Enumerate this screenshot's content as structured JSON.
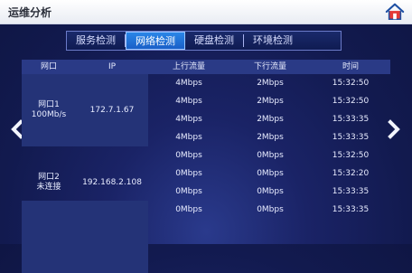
{
  "header": {
    "title": "运维分析"
  },
  "icons": {
    "home": "home-icon",
    "left": "chevron-left-icon",
    "right": "chevron-right-icon"
  },
  "tabs": [
    {
      "label": "服务检测",
      "active": false
    },
    {
      "label": "网络检测",
      "active": true
    },
    {
      "label": "硬盘检测",
      "active": false
    },
    {
      "label": "环境检测",
      "active": false
    }
  ],
  "table": {
    "headers": [
      "网口",
      "IP",
      "上行流量",
      "下行流量",
      "时间"
    ],
    "groups": [
      {
        "port": "网口1",
        "status": "100Mb/s",
        "ip": "172.7.1.67",
        "rows": [
          {
            "up": "4Mbps",
            "down": "2Mbps",
            "time": "15:32:50"
          },
          {
            "up": "4Mbps",
            "down": "2Mbps",
            "time": "15:32:50"
          },
          {
            "up": "4Mbps",
            "down": "2Mbps",
            "time": "15:33:35"
          },
          {
            "up": "4Mbps",
            "down": "2Mbps",
            "time": "15:33:35"
          }
        ]
      },
      {
        "port": "网口2",
        "status": "未连接",
        "ip": "192.168.2.108",
        "rows": [
          {
            "up": "0Mbps",
            "down": "0Mbps",
            "time": "15:32:50"
          },
          {
            "up": "0Mbps",
            "down": "0Mbps",
            "time": "15:32:20"
          },
          {
            "up": "0Mbps",
            "down": "0Mbps",
            "time": "15:33:35"
          },
          {
            "up": "0Mbps",
            "down": "0Mbps",
            "time": "15:33:35"
          }
        ]
      }
    ]
  },
  "colors": {
    "accent_tab": "#1a5fc7",
    "header_row": "#2a3a86",
    "background": "#121a4f"
  }
}
